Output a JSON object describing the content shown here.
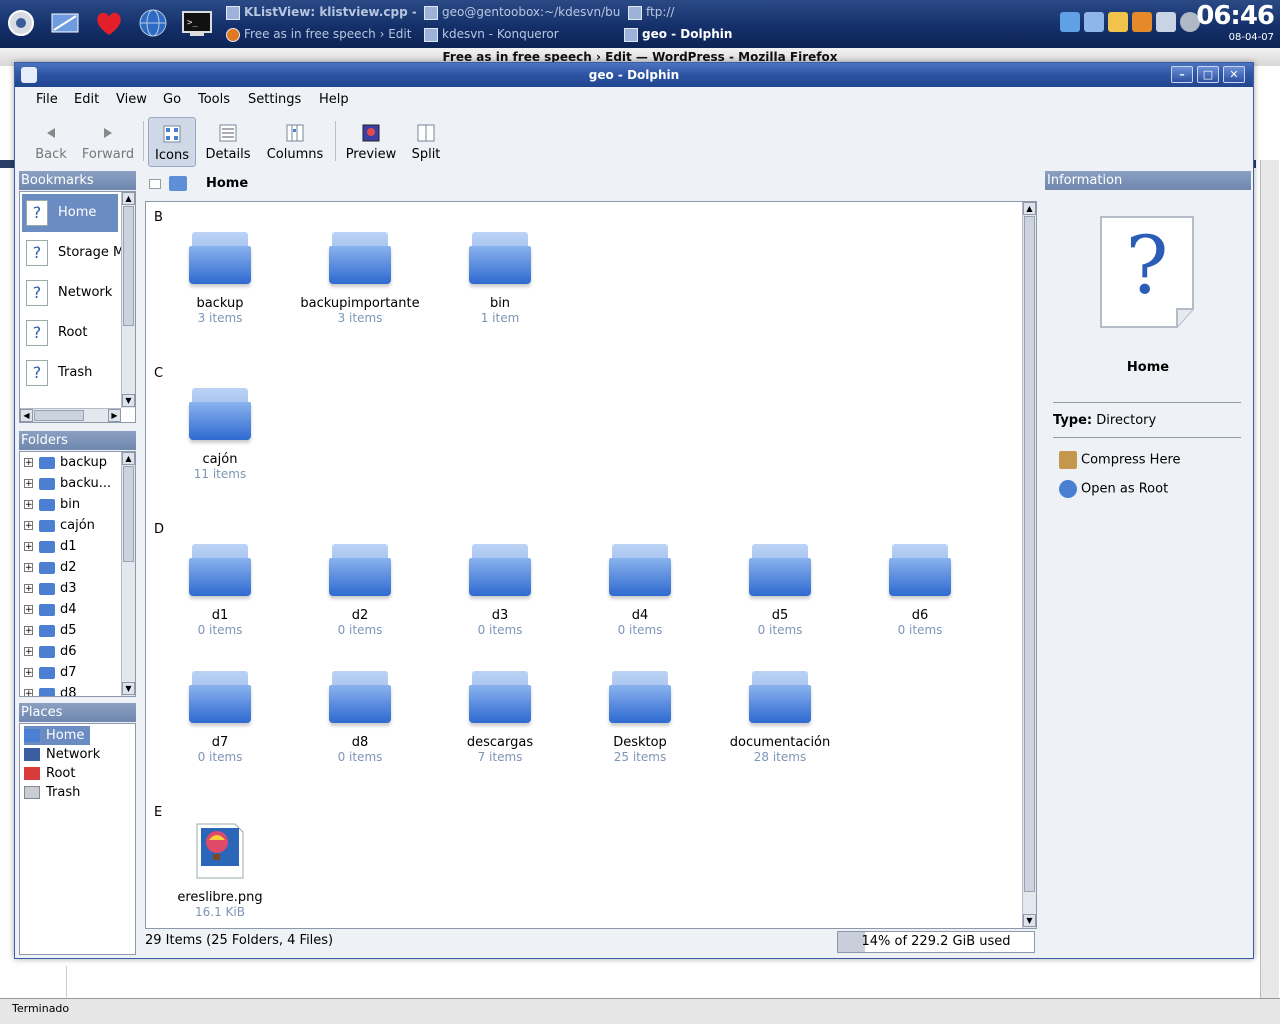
{
  "taskbar": {
    "tasks": [
      {
        "label": "KListView: klistview.cpp - Kate"
      },
      {
        "label": "geo@gentoobox:~/kdesvn/build"
      },
      {
        "label": "ftp://"
      },
      {
        "label": "Free as in free speech › Edit —"
      },
      {
        "label": "kdesvn - Konqueror"
      },
      {
        "label": "geo - Dolphin"
      }
    ],
    "clock_time": "06:46",
    "clock_date": "08-04-07"
  },
  "firefox": {
    "title": "Free as in free speech › Edit — WordPress - Mozilla Firefox",
    "status": "Terminado"
  },
  "window": {
    "title": "geo - Dolphin"
  },
  "menu": [
    "File",
    "Edit",
    "View",
    "Go",
    "Tools",
    "Settings",
    "Help"
  ],
  "toolbar": {
    "back": "Back",
    "forward": "Forward",
    "icons": "Icons",
    "details": "Details",
    "columns": "Columns",
    "preview": "Preview",
    "split": "Split"
  },
  "bookmarks": {
    "title": "Bookmarks",
    "items": [
      "Home",
      "Storage Media",
      "Network",
      "Root",
      "Trash"
    ]
  },
  "folders": {
    "title": "Folders",
    "items": [
      "backup",
      "backu...",
      "bin",
      "cajón",
      "d1",
      "d2",
      "d3",
      "d4",
      "d5",
      "d6",
      "d7",
      "d8"
    ]
  },
  "places": {
    "title": "Places",
    "items": [
      "Home",
      "Network",
      "Root",
      "Trash"
    ]
  },
  "location": {
    "breadcrumb": "Home"
  },
  "view": {
    "groups": {
      "b": "B",
      "c": "C",
      "d": "D",
      "e": "E"
    },
    "files": [
      {
        "name": "backup",
        "info": "3 items"
      },
      {
        "name": "backupimportante",
        "info": "3 items"
      },
      {
        "name": "bin",
        "info": "1 item"
      },
      {
        "name": "cajón",
        "info": "11 items"
      },
      {
        "name": "d1",
        "info": "0 items"
      },
      {
        "name": "d2",
        "info": "0 items"
      },
      {
        "name": "d3",
        "info": "0 items"
      },
      {
        "name": "d4",
        "info": "0 items"
      },
      {
        "name": "d5",
        "info": "0 items"
      },
      {
        "name": "d6",
        "info": "0 items"
      },
      {
        "name": "d7",
        "info": "0 items"
      },
      {
        "name": "d8",
        "info": "0 items"
      },
      {
        "name": "descargas",
        "info": "7 items"
      },
      {
        "name": "Desktop",
        "info": "25 items"
      },
      {
        "name": "documentación",
        "info": "28 items"
      },
      {
        "name": "ereslibre.png",
        "info": "16.1 KiB"
      }
    ]
  },
  "status": {
    "summary": "29 Items (25 Folders, 4 Files)",
    "disk": "14% of 229.2 GiB used",
    "disk_used_fraction": 0.14
  },
  "info_panel": {
    "title": "Information",
    "name": "Home",
    "type_label": "Type:",
    "type_value": "Directory",
    "actions": [
      "Compress Here",
      "Open as Root"
    ]
  },
  "colors": {
    "selection": "#6b8cc2",
    "titlebar": "#2d54a3",
    "item_count": "#7d95b7"
  }
}
